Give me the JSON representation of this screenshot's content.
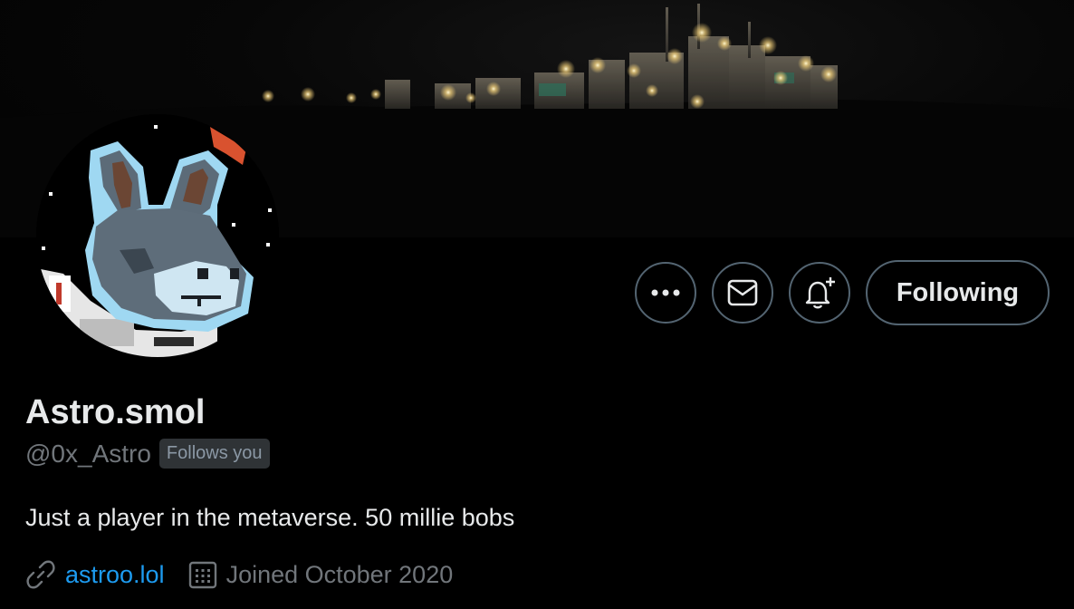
{
  "profile": {
    "display_name": "Astro.smol",
    "handle": "@0x_Astro",
    "follows_you_badge": "Follows you",
    "bio": "Just a player in the metaverse. 50 millie bobs",
    "website": "astroo.lol",
    "joined": "Joined October 2020"
  },
  "actions": {
    "more_icon": "more-dots-icon",
    "message_icon": "envelope-icon",
    "notify_icon": "bell-plus-icon",
    "follow_label": "Following"
  },
  "icons": {
    "website": "link-icon",
    "joined": "calendar-icon"
  },
  "colors": {
    "background": "#000000",
    "text_primary": "#e7e9ea",
    "text_secondary": "#71767b",
    "link": "#1d9bf0",
    "button_border": "#536471"
  }
}
